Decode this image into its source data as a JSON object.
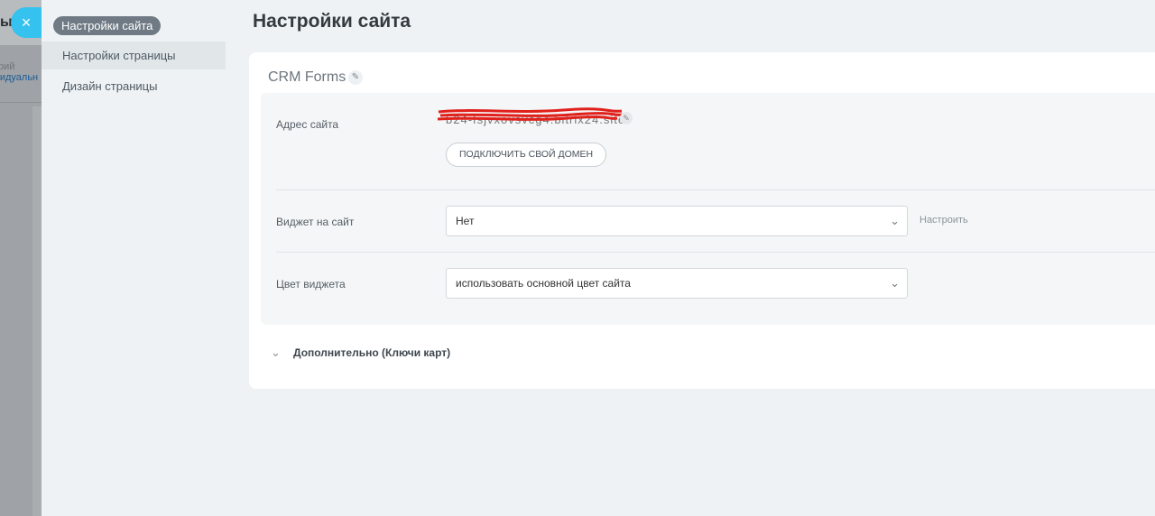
{
  "backdrop": {
    "title": "ы",
    "label": "рий",
    "value": "видуальн"
  },
  "close_icon": "×",
  "sidebar": {
    "active_item": "Настройки сайта",
    "items": [
      {
        "label": "Настройки страницы"
      },
      {
        "label": "Дизайн страницы"
      }
    ]
  },
  "page_title": "Настройки сайта",
  "card": {
    "title": "CRM Forms",
    "edit_icon": "✎",
    "address": {
      "label": "Адрес сайта",
      "value": "b24-fsjvxovsvcg4.bitrix24.site",
      "edit_icon": "✎",
      "connect_button": "ПОДКЛЮЧИТЬ СВОЙ ДОМЕН"
    },
    "widget": {
      "label": "Виджет на сайт",
      "value": "Нет",
      "configure": "Настроить"
    },
    "widget_color": {
      "label": "Цвет виджета",
      "value": "использовать основной цвет сайта"
    },
    "chevron_icon": "⌄",
    "additional": "Дополнительно (Ключи карт)"
  },
  "colors": {
    "accent": "#35c2ee",
    "sidebar_active_bg": "#6f7a84",
    "redaction": "#e0201b"
  }
}
